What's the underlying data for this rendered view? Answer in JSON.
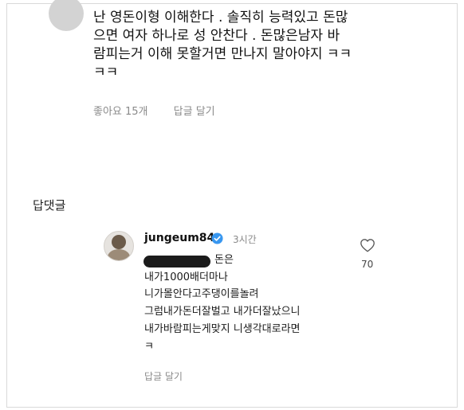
{
  "comment": {
    "lines": [
      "난 영돈이형 이해한다 . 솔직히 능력있고 돈많",
      "으면 여자 하나로 성 안찬다 .  돈많은남자 바",
      "람피는거 이해 못할거면 만나지 말아야지 ㅋㅋ",
      "ㅋㅋ"
    ],
    "likes_label": "좋아요 15개",
    "reply_label": "답글 달기"
  },
  "replies_heading": "답댓글",
  "reply": {
    "username": "jungeum84",
    "time": "3시간",
    "lines": [
      "돈은",
      "내가1000배더마나",
      "니가몰안다고주댕이를놀려",
      "그럼내가돈더잘벌고 내가더잘났으니",
      "내가바람피는게맞지 니생각대로라면",
      "ㅋ"
    ],
    "reply_label": "답글 달기",
    "like_count": "70"
  },
  "icons": {
    "verified": "verified-badge-icon",
    "heart": "heart-icon"
  },
  "colors": {
    "verified_blue": "#3897f0",
    "muted_text": "#8a8a8a"
  }
}
